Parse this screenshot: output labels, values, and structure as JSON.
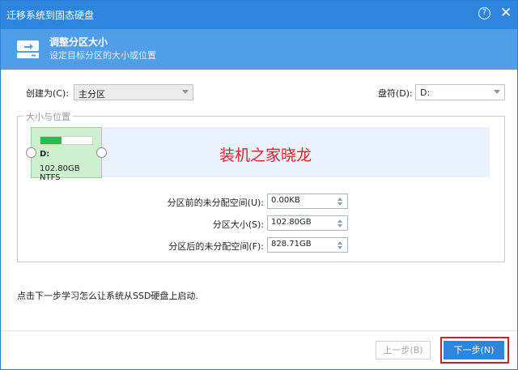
{
  "window": {
    "title": "迁移系统到固态硬盘",
    "help_icon": "question-circle-icon",
    "close_icon": "close-icon"
  },
  "header": {
    "title": "调整分区大小",
    "subtitle": "设定目标分区的大小或位置",
    "icon": "disk-icon"
  },
  "create_as": {
    "label": "创建为(C):",
    "value": "主分区"
  },
  "drive_letter": {
    "label": "盘符(D):",
    "value": "D:"
  },
  "group": {
    "legend": "大小与位置"
  },
  "partition": {
    "letter": "D:",
    "size_fs": "102.80GB NTFS",
    "used_fraction": 0.4
  },
  "watermark": "装机之家晓龙",
  "fields": [
    {
      "label": "分区前的未分配空间(U):",
      "value": "0.00KB"
    },
    {
      "label": "分区大小(S):",
      "value": "102.80GB"
    },
    {
      "label": "分区后的未分配空间(F):",
      "value": "828.71GB"
    }
  ],
  "hint": "点击下一步学习怎么让系统从SSD硬盘上启动.",
  "buttons": {
    "prev": "上一步(B)",
    "next": "下一步(N)"
  },
  "colors": {
    "titlebar": "#2e86dc",
    "header": "#509ee9",
    "accent": "#2e86dc",
    "highlight": "#c8242b"
  }
}
